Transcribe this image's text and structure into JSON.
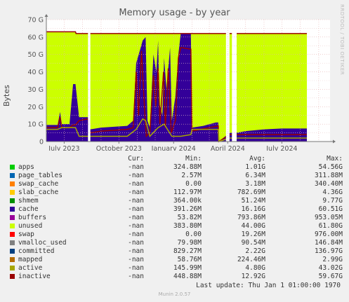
{
  "chart_data": {
    "type": "area",
    "title": "Memory usage - by year",
    "ylabel": "Bytes",
    "watermark": "RRDTOOL / TOBI OETIKER",
    "ylim": [
      0,
      70
    ],
    "y_unit": "G",
    "y_ticks": [
      "0",
      "10 G",
      "20 G",
      "30 G",
      "40 G",
      "50 G",
      "60 G",
      "70 G"
    ],
    "x_range": [
      "2023-06-01",
      "2024-09-20"
    ],
    "x_ticks": [
      {
        "label": "July 2023",
        "date": "2023-07-01"
      },
      {
        "label": "October 2023",
        "date": "2023-10-01"
      },
      {
        "label": "January 2024",
        "date": "2024-01-01"
      },
      {
        "label": "April 2024",
        "date": "2024-04-01"
      },
      {
        "label": "July 2024",
        "date": "2024-07-01"
      }
    ],
    "unused_total": [
      [
        "2023-06-01",
        63
      ],
      [
        "2023-07-20",
        63
      ],
      [
        "2023-07-21",
        62
      ],
      [
        "2023-09-20",
        62
      ],
      [
        "2023-11-05",
        62
      ],
      [
        "2023-12-20",
        62
      ],
      [
        "2024-01-31",
        62
      ],
      [
        "2024-03-16",
        62
      ],
      [
        "2024-03-28",
        62
      ],
      [
        "2024-04-20",
        62
      ],
      [
        "2024-07-15",
        62
      ],
      [
        "2024-08-12",
        62
      ]
    ],
    "gaps": [
      [
        "2023-08-10",
        "2023-08-14"
      ],
      [
        "2024-03-29",
        "2024-04-04"
      ],
      [
        "2024-04-08",
        "2024-04-16"
      ]
    ],
    "cache": [
      [
        "2023-06-01",
        9.5
      ],
      [
        "2023-06-20",
        9.5
      ],
      [
        "2023-06-24",
        17
      ],
      [
        "2023-06-27",
        10
      ],
      [
        "2023-07-10",
        10
      ],
      [
        "2023-07-16",
        33
      ],
      [
        "2023-07-20",
        33
      ],
      [
        "2023-07-26",
        14
      ],
      [
        "2023-08-10",
        14
      ],
      [
        "2023-08-14",
        7
      ],
      [
        "2023-09-01",
        8
      ],
      [
        "2023-10-15",
        9
      ],
      [
        "2023-10-25",
        12
      ],
      [
        "2023-10-30",
        45
      ],
      [
        "2023-11-05",
        52
      ],
      [
        "2023-11-10",
        58
      ],
      [
        "2023-11-15",
        60
      ],
      [
        "2023-11-18",
        12
      ],
      [
        "2023-11-22",
        8
      ],
      [
        "2023-11-28",
        50
      ],
      [
        "2023-12-03",
        40
      ],
      [
        "2023-12-06",
        58
      ],
      [
        "2023-12-08",
        22
      ],
      [
        "2023-12-13",
        15
      ],
      [
        "2023-12-16",
        48
      ],
      [
        "2023-12-20",
        30
      ],
      [
        "2023-12-26",
        54
      ],
      [
        "2023-12-29",
        12
      ],
      [
        "2024-01-04",
        26
      ],
      [
        "2024-01-09",
        50
      ],
      [
        "2024-01-13",
        62
      ],
      [
        "2024-01-24",
        62
      ],
      [
        "2024-01-30",
        62
      ],
      [
        "2024-02-01",
        8
      ],
      [
        "2024-02-20",
        9
      ],
      [
        "2024-03-12",
        11
      ],
      [
        "2024-03-16",
        11
      ],
      [
        "2024-03-17",
        0
      ],
      [
        "2024-04-04",
        5
      ],
      [
        "2024-04-08",
        5
      ],
      [
        "2024-04-16",
        5
      ],
      [
        "2024-05-01",
        6
      ],
      [
        "2024-06-01",
        7
      ],
      [
        "2024-07-01",
        7.5
      ],
      [
        "2024-08-12",
        7.5
      ]
    ],
    "inactive": [
      [
        "2023-06-01",
        8
      ],
      [
        "2023-06-20",
        8
      ],
      [
        "2023-06-24",
        14
      ],
      [
        "2023-06-27",
        8
      ],
      [
        "2023-07-10",
        8
      ],
      [
        "2023-07-16",
        9.5
      ],
      [
        "2023-07-20",
        9.5
      ],
      [
        "2023-07-26",
        12
      ],
      [
        "2023-08-10",
        13
      ],
      [
        "2023-08-14",
        5
      ],
      [
        "2023-09-01",
        6
      ],
      [
        "2023-10-15",
        7
      ],
      [
        "2023-10-25",
        8
      ],
      [
        "2023-10-30",
        40
      ],
      [
        "2023-11-03",
        15
      ],
      [
        "2023-11-08",
        52
      ],
      [
        "2023-11-13",
        20
      ],
      [
        "2023-11-16",
        3
      ],
      [
        "2023-11-22",
        5
      ],
      [
        "2023-11-28",
        38
      ],
      [
        "2023-12-02",
        20
      ],
      [
        "2023-12-06",
        42
      ],
      [
        "2023-12-09",
        10
      ],
      [
        "2023-12-15",
        40
      ],
      [
        "2023-12-18",
        8
      ],
      [
        "2023-12-23",
        42
      ],
      [
        "2023-12-28",
        5
      ],
      [
        "2024-01-04",
        12
      ],
      [
        "2024-01-09",
        48
      ],
      [
        "2024-01-13",
        54
      ],
      [
        "2024-01-30",
        53
      ],
      [
        "2024-02-01",
        6
      ],
      [
        "2024-03-16",
        9
      ],
      [
        "2024-03-17",
        0
      ],
      [
        "2024-04-04",
        4
      ],
      [
        "2024-04-08",
        4
      ],
      [
        "2024-04-16",
        4
      ],
      [
        "2024-08-12",
        4
      ]
    ],
    "active": [
      [
        "2023-06-01",
        7
      ],
      [
        "2023-06-20",
        7
      ],
      [
        "2023-06-27",
        8
      ],
      [
        "2023-07-15",
        8
      ],
      [
        "2023-07-20",
        8
      ],
      [
        "2023-07-26",
        3
      ],
      [
        "2023-08-14",
        3
      ],
      [
        "2023-09-01",
        3
      ],
      [
        "2023-10-15",
        3
      ],
      [
        "2023-10-30",
        7
      ],
      [
        "2023-11-10",
        13
      ],
      [
        "2023-11-15",
        12
      ],
      [
        "2023-11-22",
        3
      ],
      [
        "2023-12-06",
        8
      ],
      [
        "2023-12-16",
        10
      ],
      [
        "2023-12-29",
        3
      ],
      [
        "2024-01-13",
        3
      ],
      [
        "2024-01-30",
        4
      ],
      [
        "2024-02-01",
        7
      ],
      [
        "2024-03-16",
        7
      ],
      [
        "2024-03-17",
        0
      ],
      [
        "2024-04-04",
        2
      ],
      [
        "2024-08-12",
        2
      ]
    ],
    "series_legend": [
      {
        "name": "apps",
        "color": "#00cc00",
        "cur": "-nan",
        "min": "324.88M",
        "avg": "1.01G",
        "max": "54.56G"
      },
      {
        "name": "page_tables",
        "color": "#0066b3",
        "cur": "-nan",
        "min": "2.57M",
        "avg": "6.34M",
        "max": "311.88M"
      },
      {
        "name": "swap_cache",
        "color": "#ff8000",
        "cur": "-nan",
        "min": "0.00",
        "avg": "3.18M",
        "max": "340.40M"
      },
      {
        "name": "slab_cache",
        "color": "#ffcc00",
        "cur": "-nan",
        "min": "112.97M",
        "avg": "782.69M",
        "max": "4.36G"
      },
      {
        "name": "shmem",
        "color": "#008f00",
        "cur": "-nan",
        "min": "364.00k",
        "avg": "51.24M",
        "max": "9.77G"
      },
      {
        "name": "cache",
        "color": "#330099",
        "cur": "-nan",
        "min": "391.26M",
        "avg": "16.16G",
        "max": "60.51G"
      },
      {
        "name": "buffers",
        "color": "#990099",
        "cur": "-nan",
        "min": "53.82M",
        "avg": "793.86M",
        "max": "953.05M"
      },
      {
        "name": "unused",
        "color": "#ccff00",
        "cur": "-nan",
        "min": "383.80M",
        "avg": "44.00G",
        "max": "61.80G"
      },
      {
        "name": "swap",
        "color": "#ff0000",
        "cur": "-nan",
        "min": "0.00",
        "avg": "19.26M",
        "max": "976.00M"
      },
      {
        "name": "vmalloc_used",
        "color": "#808080",
        "cur": "-nan",
        "min": "79.98M",
        "avg": "90.54M",
        "max": "146.84M"
      },
      {
        "name": "committed",
        "color": "#004080",
        "cur": "-nan",
        "min": "829.27M",
        "avg": "2.22G",
        "max": "136.97G"
      },
      {
        "name": "mapped",
        "color": "#b36b00",
        "cur": "-nan",
        "min": "58.76M",
        "avg": "224.46M",
        "max": "2.99G"
      },
      {
        "name": "active",
        "color": "#a6a600",
        "cur": "-nan",
        "min": "145.99M",
        "avg": "4.80G",
        "max": "43.02G"
      },
      {
        "name": "inactive",
        "color": "#990000",
        "cur": "-nan",
        "min": "448.88M",
        "avg": "12.92G",
        "max": "59.67G"
      }
    ],
    "legend_header": {
      "cur": "Cur:",
      "min": "Min:",
      "avg": "Avg:",
      "max": "Max:"
    }
  },
  "footer": {
    "last_update": "Last update: Thu Jan  1 01:00:00 1970",
    "munin_version": "Munin 2.0.57"
  }
}
